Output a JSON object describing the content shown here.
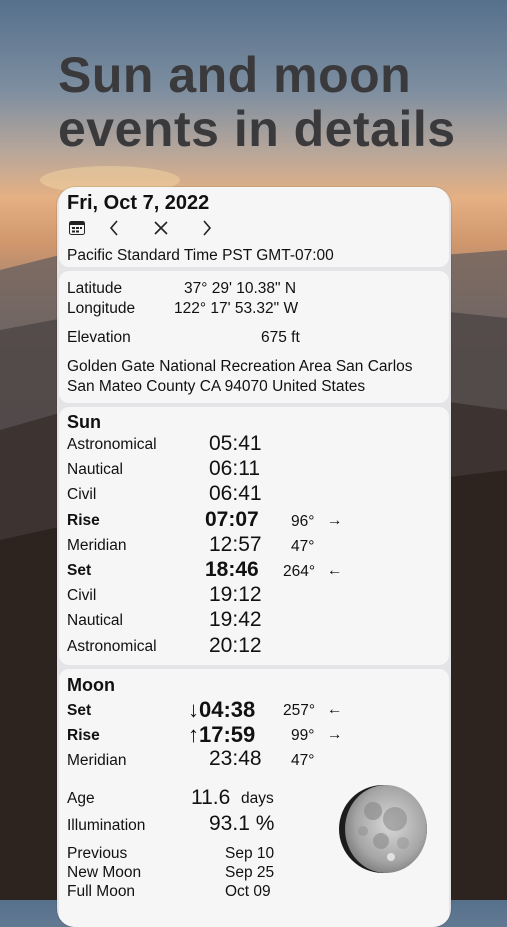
{
  "headline": {
    "line1": "Sun and moon",
    "line2": "events in details"
  },
  "card": {
    "date": "Fri, Oct 7, 2022",
    "toolbar": {
      "calendar_icon": "calendar-icon",
      "prev_icon": "chevron-left-icon",
      "close_icon": "close-icon",
      "next_icon": "chevron-right-icon"
    },
    "timezone": "Pacific Standard Time PST GMT-07:00"
  },
  "location": {
    "latitude_label": "Latitude",
    "latitude_value": "37° 29' 10.38\" N",
    "longitude_label": "Longitude",
    "longitude_value": "122° 17' 53.32\" W",
    "elevation_label": "Elevation",
    "elevation_value": "675 ft",
    "address_line1": "Golden Gate National Recreation Area San Carlos",
    "address_line2": "San Mateo County CA 94070 United States"
  },
  "sun": {
    "title": "Sun",
    "rows": [
      {
        "label": "Astronomical",
        "time": "05:41",
        "bold": false,
        "azimuth": "",
        "arrow": ""
      },
      {
        "label": "Nautical",
        "time": "06:11",
        "bold": false,
        "azimuth": "",
        "arrow": ""
      },
      {
        "label": "Civil",
        "time": "06:41",
        "bold": false,
        "azimuth": "",
        "arrow": ""
      },
      {
        "label": "Rise",
        "time": "07:07",
        "bold": true,
        "azimuth": "96°",
        "arrow": "→"
      },
      {
        "label": "Meridian",
        "time": "12:57",
        "bold": false,
        "azimuth": "47°",
        "arrow": ""
      },
      {
        "label": "Set",
        "time": "18:46",
        "bold": true,
        "azimuth": "264°",
        "arrow": "←"
      },
      {
        "label": "Civil",
        "time": "19:12",
        "bold": false,
        "azimuth": "",
        "arrow": ""
      },
      {
        "label": "Nautical",
        "time": "19:42",
        "bold": false,
        "azimuth": "",
        "arrow": ""
      },
      {
        "label": "Astronomical",
        "time": "20:12",
        "bold": false,
        "azimuth": "",
        "arrow": ""
      }
    ]
  },
  "moon": {
    "title": "Moon",
    "set_label": "Set",
    "set_time": "↓04:38",
    "set_azimuth": "257°",
    "set_arrow": "←",
    "rise_label": "Rise",
    "rise_time": "↑17:59",
    "rise_azimuth": "99°",
    "rise_arrow": "→",
    "meridian_label": "Meridian",
    "meridian_time": "23:48",
    "meridian_azimuth": "47°",
    "age_label": "Age",
    "age_value": "11.6",
    "age_unit": "days",
    "illumination_label": "Illumination",
    "illumination_value": "93.1 %",
    "previous_label": "Previous",
    "previous_date": "Sep 10",
    "new_moon_label": "New Moon",
    "new_moon_date": "Sep 25",
    "full_moon_label": "Full Moon",
    "full_moon_date": "Oct 09",
    "image_icon": "moon-phase-icon"
  },
  "colors": {
    "card_bg": "#f6f6f6",
    "card_border": "#e4e4e7",
    "headline": "#3a3a3c"
  }
}
